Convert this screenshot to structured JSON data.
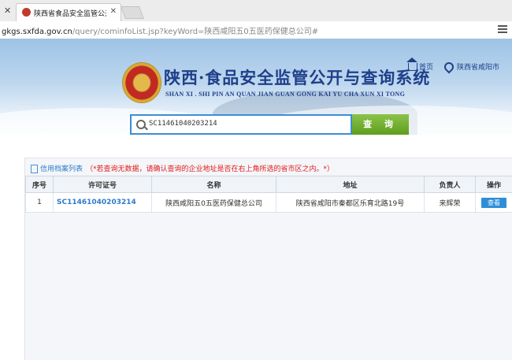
{
  "browser": {
    "tab_title": "陕西省食品安全监管公开",
    "url_host": "gkgs.sxfda.gov.cn",
    "url_path": "/query/cominfoList.jsp?keyWord=陕西咸阳五0五医药保健总公司#"
  },
  "header": {
    "title": "陕西·食品安全监管公开与查询系统",
    "subtitle": "SHAN XI . SHI PIN AN QUAN JIAN GUAN GONG KAI YU CHA XUN XI TONG",
    "home_label": "首页",
    "region_label": "陕西省咸阳市"
  },
  "search": {
    "value": "SC11461040203214",
    "button_label": "查 询"
  },
  "panel": {
    "title": "信用档案列表",
    "note": "（*若查询无数据，请确认查询的企业地址是否在右上角所选的省市区之内。*）"
  },
  "table": {
    "headers": [
      "序号",
      "许可证号",
      "名称",
      "地址",
      "负责人",
      "操作"
    ],
    "rows": [
      [
        "1",
        "SC11461040203214",
        "陕西咸阳五0五医药保健总公司",
        "陕西省咸阳市秦都区乐育北路19号",
        "来辉荣",
        "查看"
      ]
    ]
  }
}
